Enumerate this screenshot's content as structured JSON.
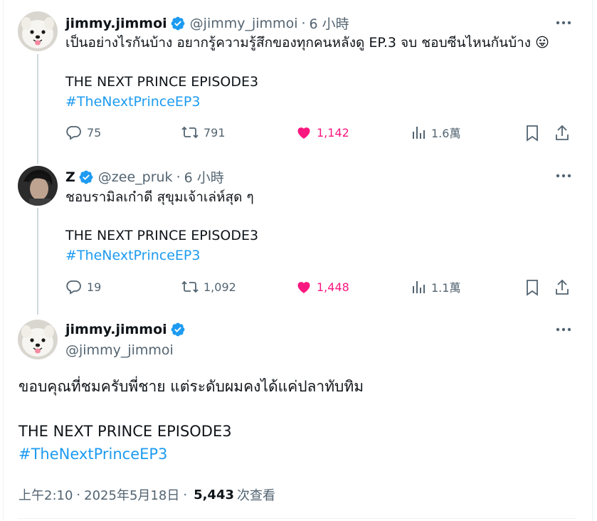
{
  "tweets": [
    {
      "name": "jimmy.jimmoi",
      "handle": "@jimmy_jimmoi",
      "sep": "·",
      "time": "6 小時",
      "text": "เป็นอย่างไรกันบ้าง อยากรู้ความรู้สึกของทุกคนหลังดู EP.3 จบ ชอบซีนไหนกันบ้าง",
      "emoji": "😛",
      "line2": "THE NEXT PRINCE EPISODE3",
      "hashtag": "#TheNextPrinceEP3",
      "replies": "75",
      "reposts": "791",
      "likes": "1,142",
      "views": "1.6萬",
      "avatar_icon": "samoyed-dog-avatar"
    },
    {
      "name": "Z",
      "handle": "@zee_pruk",
      "sep": "·",
      "time": "6 小時",
      "text": "ชอบรามิลเก๋าดี สุขุมเจ้าเล่ห์สุด ๆ",
      "line2": "THE NEXT PRINCE EPISODE3",
      "hashtag": "#TheNextPrinceEP3",
      "replies": "19",
      "reposts": "1,092",
      "likes": "1,448",
      "views": "1.1萬",
      "avatar_icon": "person-photo-avatar"
    }
  ],
  "main": {
    "name": "jimmy.jimmoi",
    "handle": "@jimmy_jimmoi",
    "text": "ขอบคุณที่ชมครับพี่ชาย แต่ระดับผมคงได้แค่ปลาทับทิม",
    "line2": "THE NEXT PRINCE EPISODE3",
    "hashtag": "#TheNextPrinceEP3",
    "time": "上午2:10",
    "sep": "·",
    "date": "2025年5月18日",
    "views_count": "5,443",
    "views_label": "次查看"
  },
  "colors": {
    "accent": "#1d9bf0",
    "like": "#f91880",
    "muted": "#536471",
    "text": "#0f1419"
  }
}
